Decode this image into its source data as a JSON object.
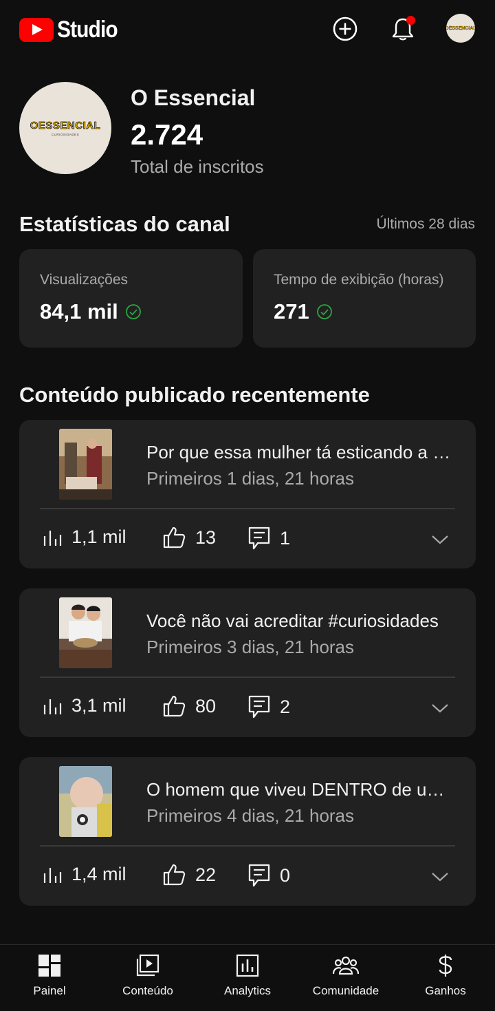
{
  "app": {
    "logo_text": "Studio",
    "brand_color": "#ff0000",
    "icons": {
      "create": "create-plus-icon",
      "notifications": "bell-icon",
      "account": "account-avatar"
    }
  },
  "channel": {
    "avatar_text_main": "OESSENCIAL",
    "avatar_text_sub": "CURIOSIDADES",
    "name": "O Essencial",
    "subscribers": "2.724",
    "subscribers_label": "Total de inscritos"
  },
  "stats": {
    "title": "Estatísticas do canal",
    "period": "Últimos 28 dias",
    "cards": [
      {
        "label": "Visualizações",
        "value": "84,1 mil",
        "icon": "check-circle-icon"
      },
      {
        "label": "Tempo de exibição (horas)",
        "value": "271",
        "icon": "check-circle-icon"
      }
    ],
    "check_color": "#2ba640"
  },
  "recent": {
    "title": "Conteúdo publicado recentemente",
    "videos": [
      {
        "title": "Por que essa mulher tá esticando a massa assim?",
        "subtitle": "Primeiros 1 dias, 21 horas",
        "views": "1,1 mil",
        "likes": "13",
        "comments": "1"
      },
      {
        "title": "Você não vai acreditar #curiosidades",
        "subtitle": "Primeiros 3 dias, 21 horas",
        "views": "3,1 mil",
        "likes": "80",
        "comments": "2"
      },
      {
        "title": "O homem que viveu DENTRO de um pulmão de aço",
        "subtitle": "Primeiros 4 dias, 21 horas",
        "views": "1,4 mil",
        "likes": "22",
        "comments": "0"
      }
    ]
  },
  "bottom_nav": [
    {
      "label": "Painel",
      "icon": "dashboard-icon"
    },
    {
      "label": "Conteúdo",
      "icon": "content-icon"
    },
    {
      "label": "Analytics",
      "icon": "analytics-icon"
    },
    {
      "label": "Comunidade",
      "icon": "community-icon"
    },
    {
      "label": "Ganhos",
      "icon": "earn-dollar-icon"
    }
  ]
}
